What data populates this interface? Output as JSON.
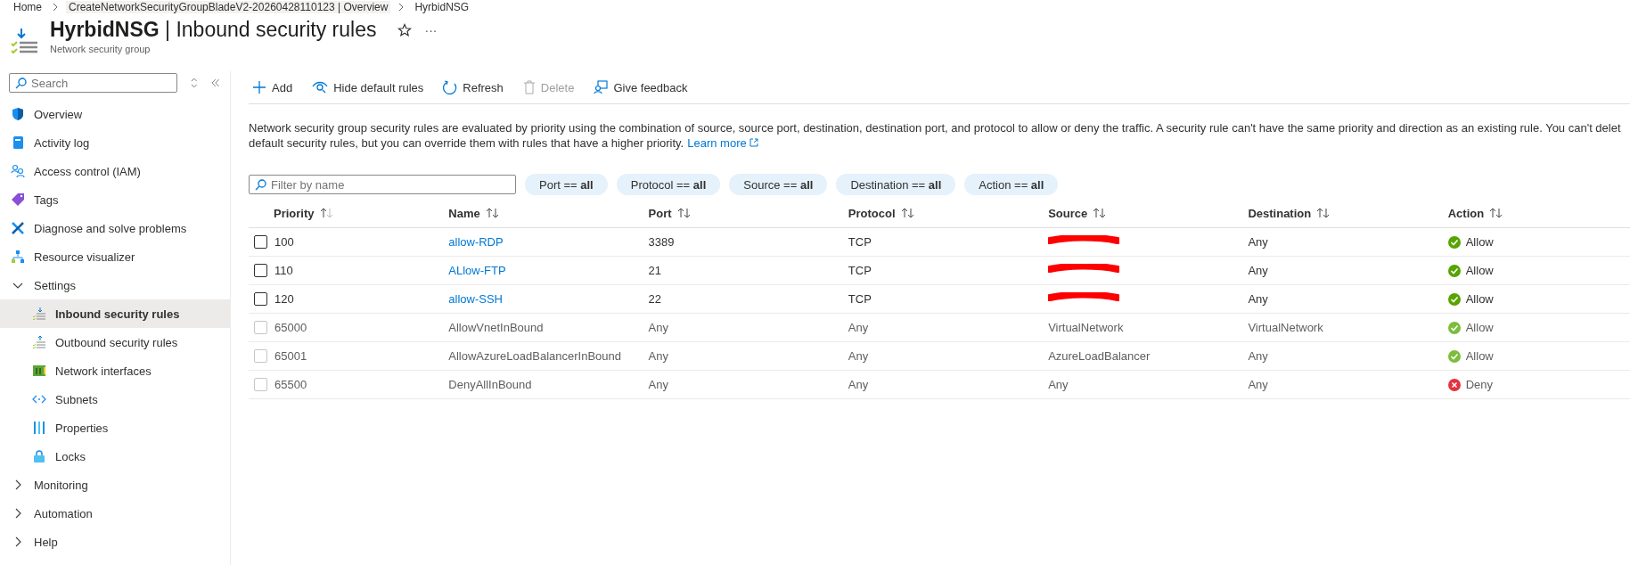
{
  "breadcrumb": [
    "Home",
    "CreateNetworkSecurityGroupBladeV2-20260428110123 | Overview",
    "HyrbidNSG"
  ],
  "header": {
    "title": "**HyrbidNSG** | Inbound security rules",
    "subtitle": "Network security group",
    "more": "···"
  },
  "sidebar": {
    "search": {
      "placeholder": "Search"
    },
    "items": [
      {
        "label": "Overview",
        "selected": false
      },
      {
        "label": "Activity log",
        "selected": false
      },
      {
        "label": "Access control (IAM)",
        "selected": false
      },
      {
        "label": "Tags",
        "selected": false
      },
      {
        "label": "Diagnose and solve problems",
        "selected": false
      },
      {
        "label": "Resource visualizer",
        "selected": false
      },
      {
        "label": "Settings",
        "kind": "group",
        "expanded": true,
        "selected": false,
        "children": [
          {
            "label": "Inbound security rules",
            "selected": true
          },
          {
            "label": "Outbound security rules",
            "selected": false
          },
          {
            "label": "Network interfaces",
            "selected": false
          },
          {
            "label": "Subnets",
            "selected": false
          },
          {
            "label": "Properties",
            "selected": false
          },
          {
            "label": "Locks",
            "selected": false
          }
        ]
      },
      {
        "label": "Monitoring",
        "kind": "group",
        "expanded": false,
        "selected": false
      },
      {
        "label": "Automation",
        "kind": "group",
        "expanded": false,
        "selected": false
      },
      {
        "label": "Help",
        "kind": "group",
        "expanded": false,
        "selected": false
      }
    ]
  },
  "toolbar": [
    {
      "label": "Add",
      "disabled": false
    },
    {
      "label": "Hide default rules",
      "disabled": false
    },
    {
      "label": "Refresh",
      "disabled": false
    },
    {
      "label": "Delete",
      "disabled": true
    },
    {
      "label": "Give feedback",
      "disabled": false
    }
  ],
  "description": {
    "lines": [
      "Network security group security rules are evaluated by priority using the combination of source, source port, destination, destination port, and protocol to allow or deny the traffic. A security rule can't have the same priority and direction as an existing rule. You can't delet",
      "default security rules, but you can override them with rules that have a higher priority."
    ],
    "link": "Learn more"
  },
  "filter": {
    "placeholder": "Filter by name",
    "pills": [
      {
        "name": "Port ==",
        "value": "all"
      },
      {
        "name": "Protocol ==",
        "value": "all"
      },
      {
        "name": "Source ==",
        "value": "all"
      },
      {
        "name": "Destination ==",
        "value": "all"
      },
      {
        "name": "Action ==",
        "value": "all"
      }
    ]
  },
  "table": {
    "columns": [
      "Priority",
      "Name",
      "Port",
      "Protocol",
      "Source",
      "Destination",
      "Action"
    ],
    "rows": [
      {
        "priority": "100",
        "name": "allow-RDP",
        "port": "3389",
        "protocol": "TCP",
        "source_redacted": true,
        "destination": "Any",
        "action": "Allow",
        "kind": "allow",
        "disabled": false
      },
      {
        "priority": "110",
        "name": "ALlow-FTP",
        "port": "21",
        "protocol": "TCP",
        "source_redacted": true,
        "destination": "Any",
        "action": "Allow",
        "kind": "allow",
        "disabled": false
      },
      {
        "priority": "120",
        "name": "allow-SSH",
        "port": "22",
        "protocol": "TCP",
        "source_redacted": true,
        "destination": "Any",
        "action": "Allow",
        "kind": "allow",
        "disabled": false
      },
      {
        "priority": "65000",
        "name": "AllowVnetInBound",
        "port": "Any",
        "protocol": "Any",
        "source": "VirtualNetwork",
        "source_redacted": false,
        "destination": "VirtualNetwork",
        "action": "Allow",
        "kind": "allow",
        "disabled": true
      },
      {
        "priority": "65001",
        "name": "AllowAzureLoadBalancerInBound",
        "port": "Any",
        "protocol": "Any",
        "source": "AzureLoadBalancer",
        "source_redacted": false,
        "destination": "Any",
        "action": "Allow",
        "kind": "allow",
        "disabled": true
      },
      {
        "priority": "65500",
        "name": "DenyAllInBound",
        "port": "Any",
        "protocol": "Any",
        "source": "Any",
        "source_redacted": false,
        "destination": "Any",
        "action": "Deny",
        "kind": "deny",
        "disabled": true
      }
    ]
  }
}
